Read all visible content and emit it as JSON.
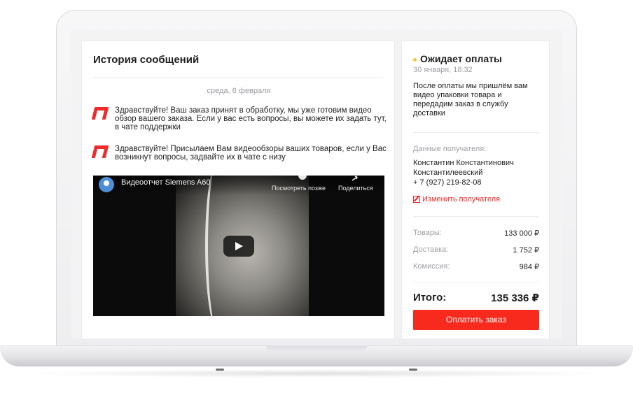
{
  "history": {
    "title": "История сообщений",
    "date_separator": "среда, 6 февраля",
    "messages": [
      {
        "text": "Здравствуйте! Ваш заказ принят в обработку, мы уже готовим видео обзор вашего заказа. Если у вас есть вопросы, вы можете их задать тут, в чате поддержки"
      },
      {
        "text": "Здравствуйте! Присылаем Вам видеообзоры ваших товаров, если у Вас возникнут вопросы, задвайте их в чате с низу"
      }
    ],
    "video": {
      "title": "Видеоотчет Siemens A60",
      "watch_later": "Посмотреть позже",
      "share": "Поделиться"
    }
  },
  "order": {
    "status": "Ожидает оплаты",
    "status_color": "#f6c23b",
    "date": "30 января, 18:32",
    "description": "После оплаты мы пришлём вам видео упаковки товара и передадим заказ в службу доставки",
    "recipient_label": "Данные получателя:",
    "recipient_name_line1": "Константин Константинович",
    "recipient_name_line2": "Константилеевский",
    "recipient_phone": "+ 7 (927) 219-82-08",
    "edit_recipient": "Изменить получателя",
    "summary": [
      {
        "label": "Товары:",
        "value": "133 000 ₽"
      },
      {
        "label": "Доставка:",
        "value": "1 752 ₽"
      },
      {
        "label": "Комиссия:",
        "value": "984 ₽"
      }
    ],
    "total_label": "Итого:",
    "total_value": "135 336 ₽",
    "pay_button": "Оплатить заказ",
    "accent_color": "#f82a1e"
  }
}
